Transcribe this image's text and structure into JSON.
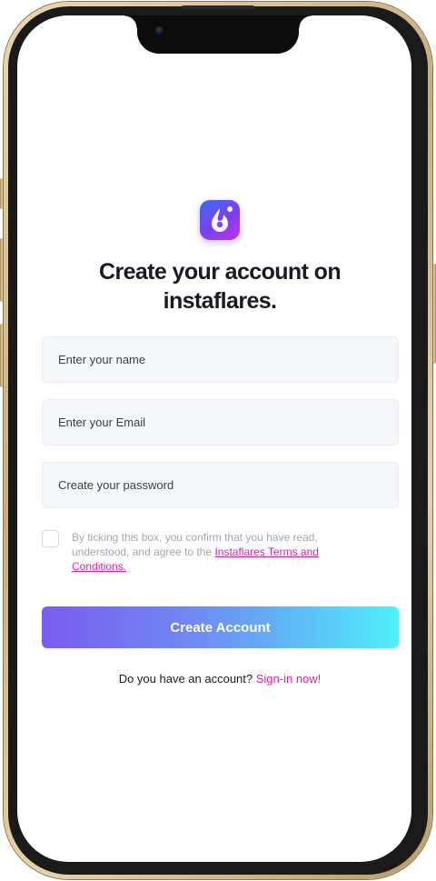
{
  "form": {
    "title": "Create your account on instaflares.",
    "name_placeholder": "Enter your name",
    "email_placeholder": "Enter your Email",
    "password_placeholder": "Create your password",
    "consent_text": "By ticking this box, you confirm that you have read, understood, and agree to the ",
    "terms_link": "Instaflares Terms and Conditions.",
    "terms_checked": false,
    "submit_label": "Create Account",
    "signin_prompt": "Do you have an account?",
    "signin_link": "Sign-in now!"
  },
  "icons": {
    "logo": "water-drop-logo-icon",
    "camera": "front-camera-icon"
  },
  "colors": {
    "accent_pink": "#e01ea4",
    "button_gradient_start": "#7a5cf0",
    "button_gradient_end": "#4ff0fb",
    "field_background": "#f5f7fb",
    "title_text": "#1a1a22",
    "frame_gold": "#c9ad7e"
  }
}
